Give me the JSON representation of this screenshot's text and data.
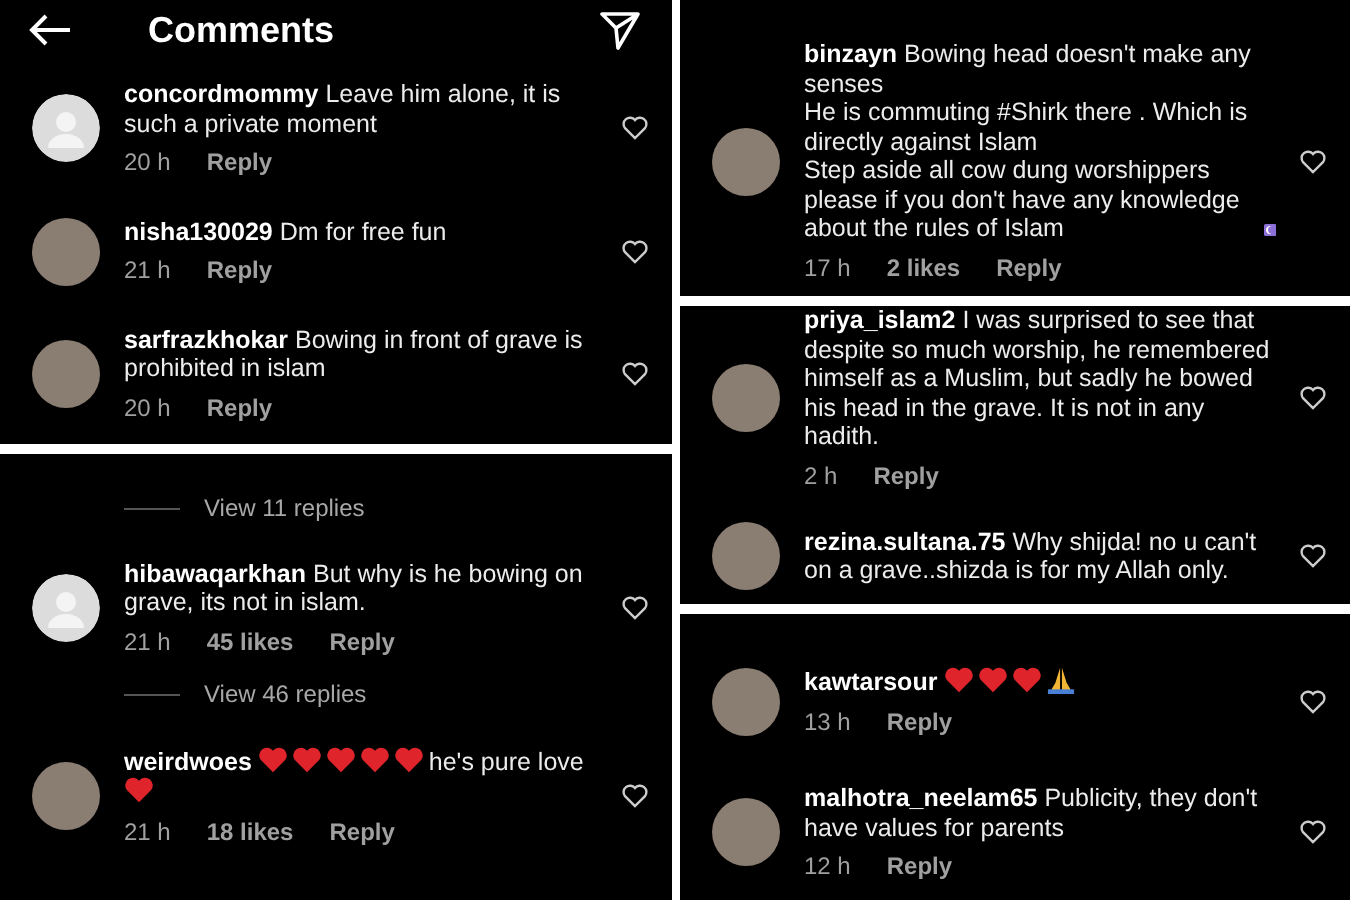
{
  "columns": [
    [
      {
        "header": {
          "title": "Comments"
        },
        "items": [
          {
            "kind": "comment",
            "avatar": {
              "kind": "default"
            },
            "username": "concordmommy",
            "body": [
              {
                "kind": "text",
                "text": "Leave him alone, it is such a private moment"
              }
            ],
            "time": "20 h",
            "reply": "Reply"
          },
          {
            "kind": "comment",
            "avatar": {
              "kind": "photo"
            },
            "username": "nisha130029",
            "body": [
              {
                "kind": "text",
                "text": "Dm for free fun"
              }
            ],
            "time": "21 h",
            "reply": "Reply"
          },
          {
            "kind": "comment",
            "avatar": {
              "kind": "photo"
            },
            "username": "sarfrazkhokar",
            "body": [
              {
                "kind": "text",
                "text": "Bowing in front of grave is prohibited in islam"
              }
            ],
            "time": "20 h",
            "reply": "Reply"
          }
        ]
      },
      {
        "items": [
          {
            "kind": "view_replies",
            "text": "View 11 replies"
          },
          {
            "kind": "comment",
            "avatar": {
              "kind": "default"
            },
            "username": "hibawaqarkhan",
            "body": [
              {
                "kind": "text",
                "text": "But why is he bowing on grave, its not in islam."
              }
            ],
            "time": "21 h",
            "likes": "45 likes",
            "reply": "Reply"
          },
          {
            "kind": "view_replies",
            "text": "View 46 replies"
          },
          {
            "kind": "comment",
            "avatar": {
              "kind": "photo"
            },
            "username": "weirdwoes",
            "body": [
              {
                "kind": "heart"
              },
              {
                "kind": "heart"
              },
              {
                "kind": "heart"
              },
              {
                "kind": "heart"
              },
              {
                "kind": "heart"
              },
              {
                "kind": "text",
                "text": "he's pure love"
              },
              {
                "kind": "heart"
              }
            ],
            "time": "21 h",
            "likes": "18 likes",
            "reply": "Reply"
          }
        ]
      }
    ],
    [
      {
        "items": [
          {
            "kind": "comment",
            "avatar": {
              "kind": "photo"
            },
            "username": "binzayn",
            "body": [
              {
                "kind": "text",
                "text": "Bowing head doesn't make any senses\nHe is commuting #Shirk there . Which is directly against Islam\nStep aside all cow dung worshippers please if you don't have any knowledge about the rules of Islam"
              },
              {
                "kind": "crescent"
              }
            ],
            "time": "17 h",
            "likes": "2 likes",
            "reply": "Reply"
          }
        ]
      },
      {
        "items": [
          {
            "kind": "comment",
            "avatar": {
              "kind": "photo"
            },
            "username": "priya_islam2",
            "body": [
              {
                "kind": "text",
                "text": "I was surprised to see that despite so much worship, he remembered himself as a Muslim, but sadly he bowed his head in the grave. It is not in any hadith."
              }
            ],
            "time": "2 h",
            "reply": "Reply"
          },
          {
            "kind": "comment",
            "avatar": {
              "kind": "photo"
            },
            "username": "rezina.sultana.75",
            "body": [
              {
                "kind": "text",
                "text": "Why shijda! no u can't on a grave..shizda is for my Allah only."
              }
            ]
          }
        ]
      },
      {
        "items": [
          {
            "kind": "comment",
            "avatar": {
              "kind": "photo"
            },
            "username": "kawtarsour",
            "body": [
              {
                "kind": "heart"
              },
              {
                "kind": "heart"
              },
              {
                "kind": "heart"
              },
              {
                "kind": "pray"
              }
            ],
            "time": "13 h",
            "reply": "Reply"
          },
          {
            "kind": "comment",
            "avatar": {
              "kind": "photo"
            },
            "username": "malhotra_neelam65",
            "body": [
              {
                "kind": "text",
                "text": "Publicity, they don't have values for parents"
              }
            ],
            "time": "12 h",
            "reply": "Reply"
          }
        ]
      }
    ]
  ]
}
